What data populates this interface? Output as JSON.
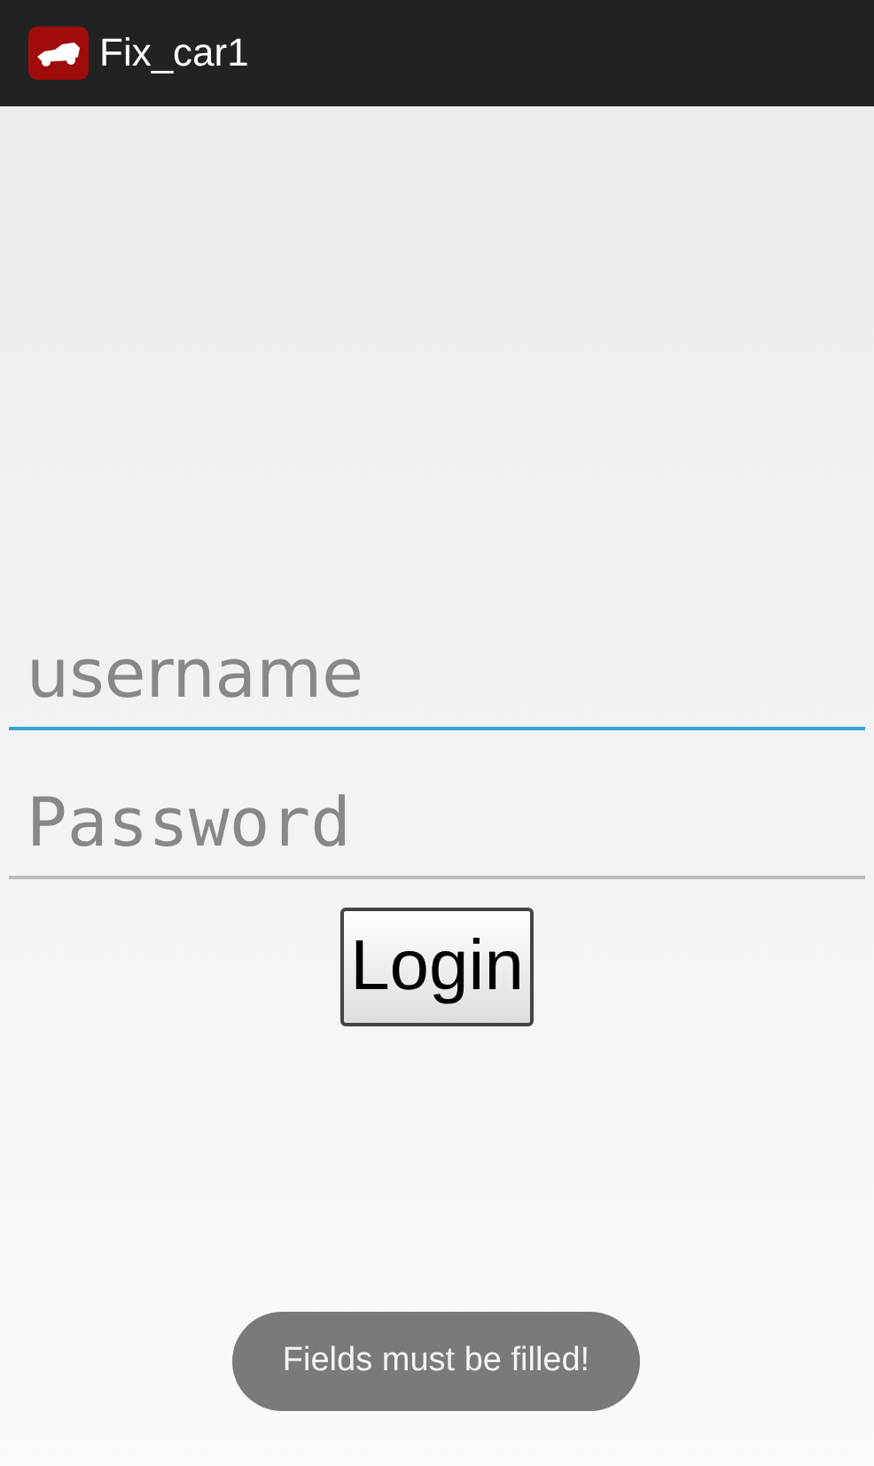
{
  "action_bar": {
    "title": "Fix_car1"
  },
  "fields": [
    {
      "placeholder": "username",
      "focused": true,
      "kind": "text"
    },
    {
      "placeholder": "Password",
      "focused": false,
      "kind": "password"
    }
  ],
  "button": {
    "label": "Login"
  },
  "toast": {
    "text": "Fields must be filled!"
  }
}
